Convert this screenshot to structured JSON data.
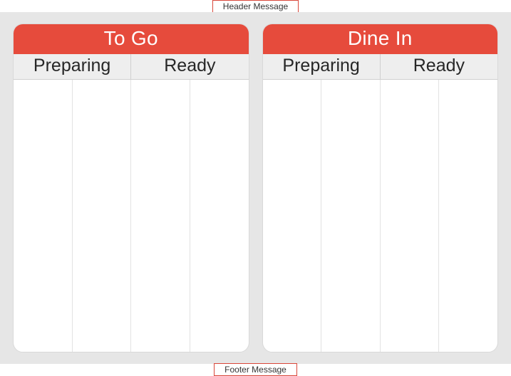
{
  "header_message": "Header Message",
  "footer_message": "Footer Message",
  "panels": {
    "togo": {
      "title": "To Go",
      "col_preparing_label": "Preparing",
      "col_ready_label": "Ready"
    },
    "dinein": {
      "title": "Dine In",
      "col_preparing_label": "Preparing",
      "col_ready_label": "Ready"
    }
  }
}
